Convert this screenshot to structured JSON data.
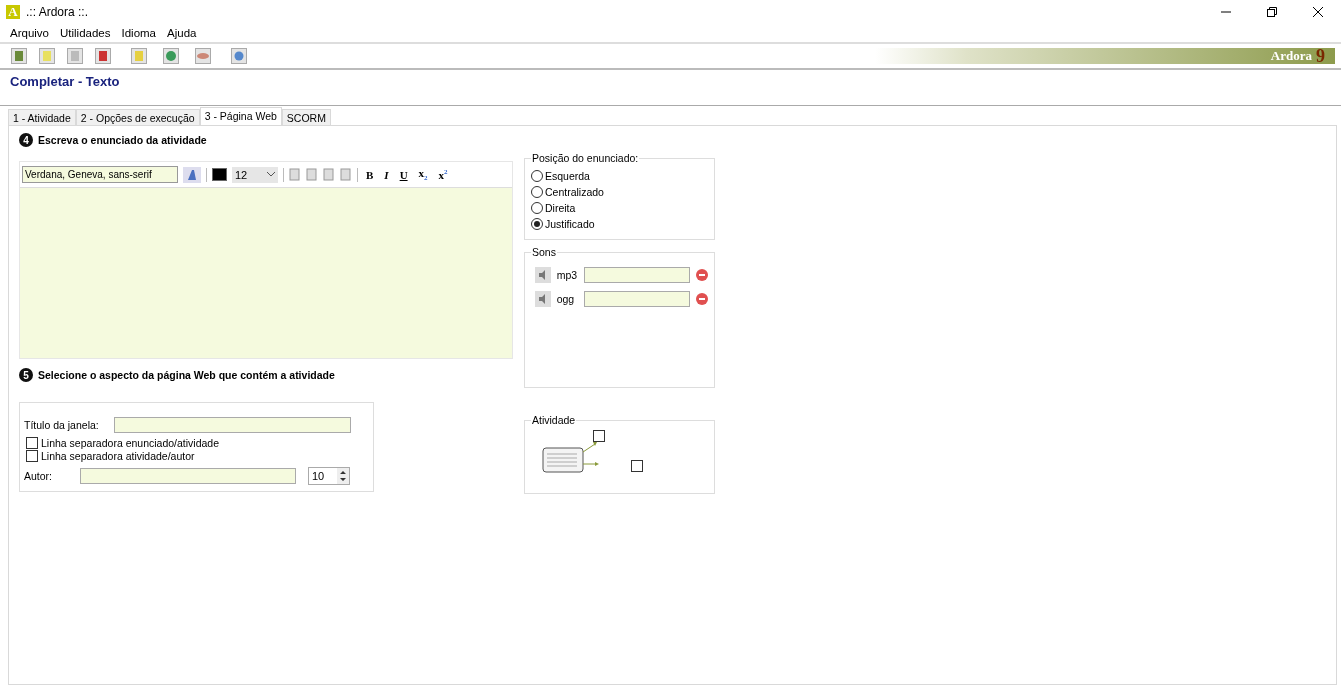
{
  "window": {
    "app_letter": "A",
    "title": ".:: Ardora ::."
  },
  "menu": [
    "Arquivo",
    "Utilidades",
    "Idioma",
    "Ajuda"
  ],
  "brand": {
    "name": "Ardora",
    "version": "9"
  },
  "heading": "Completar - Texto",
  "tabs": [
    {
      "label": "1 - Atividade",
      "selected": false
    },
    {
      "label": "2 - Opções de execução",
      "selected": false
    },
    {
      "label": "3 - Página Web",
      "selected": true
    },
    {
      "label": "SCORM",
      "selected": false
    }
  ],
  "statement": {
    "number": "4",
    "title": "Escreva o enunciado da atividade",
    "font": "Verdana, Geneva, sans-serif",
    "size": "12",
    "format": [
      "B",
      "I",
      "U",
      "x$_{2}$",
      "x$^{2}$"
    ]
  },
  "position": {
    "legend": "Posição do enunciado:",
    "options": [
      {
        "label": "Esquerda",
        "selected": false
      },
      {
        "label": "Centralizado",
        "selected": false
      },
      {
        "label": "Direita",
        "selected": false
      },
      {
        "label": "Justificado",
        "selected": true
      }
    ]
  },
  "sounds": {
    "legend": "Sons",
    "rows": [
      {
        "label": "mp3"
      },
      {
        "label": "ogg"
      }
    ]
  },
  "page": {
    "number": "5",
    "title": "Selecione o aspecto da página Web que contém a atividade",
    "window_title_label": "Título da janela:",
    "checkboxes": [
      {
        "label": "Linha separadora enunciado/atividade",
        "checked": false
      },
      {
        "label": "Linha separadora atividade/autor",
        "checked": false
      }
    ],
    "author_label": "Autor:",
    "author_size": "10"
  },
  "activity": {
    "legend": "Atividade",
    "targets": [
      {
        "checked": false
      },
      {
        "checked": false
      }
    ]
  }
}
